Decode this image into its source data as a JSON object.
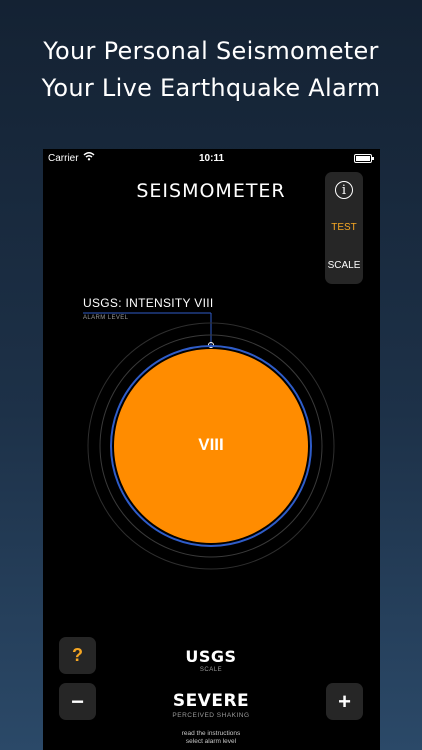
{
  "promo": {
    "line1": "Your Personal Seismometer",
    "line2": "Your Live Earthquake Alarm"
  },
  "status_bar": {
    "carrier": "Carrier",
    "time": "10:11"
  },
  "app": {
    "title": "SEISMOMETER"
  },
  "side_panel": {
    "info_label": "i",
    "test_label": "TEST",
    "scale_label": "SCALE"
  },
  "alarm": {
    "label": "USGS: INTENSITY VIII",
    "sublabel": "ALARM LEVEL"
  },
  "dial": {
    "intensity": "VIII"
  },
  "controls": {
    "help_label": "?",
    "minus_label": "−",
    "plus_label": "+",
    "scale_name": "USGS",
    "scale_sub": "SCALE",
    "shaking": "SEVERE",
    "shaking_sub": "PERCEIVED SHAKING",
    "instruction_1": "read the instructions",
    "instruction_2": "select alarm level"
  },
  "colors": {
    "accent_orange": "#ff8c00",
    "test_orange": "#f5a623",
    "ring_blue": "#2f5cc8",
    "background": "#000000"
  }
}
